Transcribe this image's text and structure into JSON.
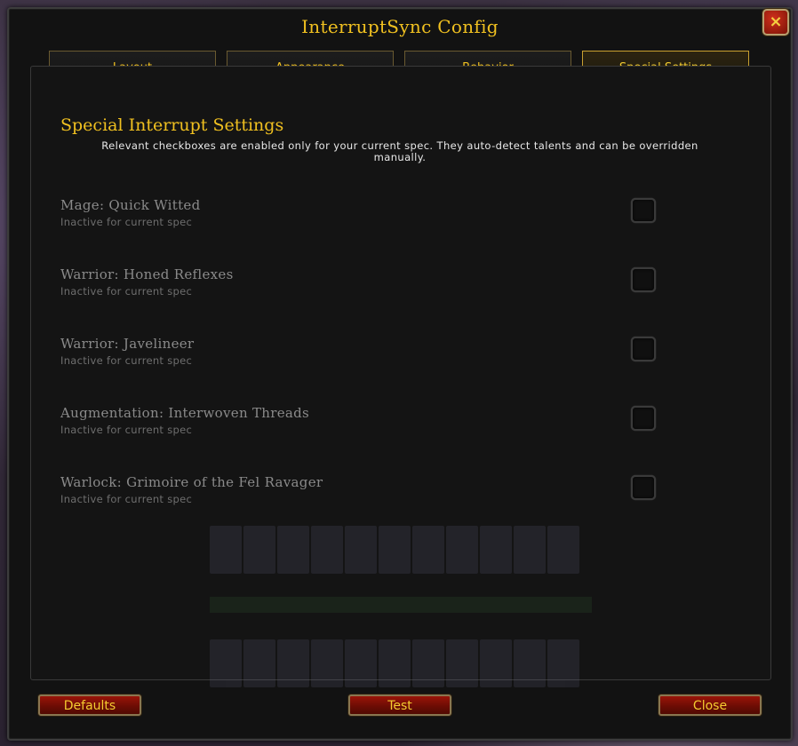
{
  "window": {
    "title": "InterruptSync Config",
    "close_icon": "×"
  },
  "tabs": [
    {
      "label": "Layout",
      "active": false
    },
    {
      "label": "Appearance",
      "active": false
    },
    {
      "label": "Behavior",
      "active": false
    },
    {
      "label": "Special Settings",
      "active": true
    }
  ],
  "section": {
    "title": "Special Interrupt Settings",
    "description": "Relevant checkboxes are enabled only for your current spec. They auto-detect talents and can be overridden manually."
  },
  "settings": [
    {
      "label": "Mage: Quick Witted",
      "status": "Inactive for current spec",
      "checked": false
    },
    {
      "label": "Warrior: Honed Reflexes",
      "status": "Inactive for current spec",
      "checked": false
    },
    {
      "label": "Warrior: Javelineer",
      "status": "Inactive for current spec",
      "checked": false
    },
    {
      "label": "Augmentation: Interwoven Threads",
      "status": "Inactive for current spec",
      "checked": false
    },
    {
      "label": "Warlock: Grimoire of the Fel Ravager",
      "status": "Inactive for current spec",
      "checked": false
    }
  ],
  "footer": {
    "defaults_label": "Defaults",
    "test_label": "Test",
    "close_label": "Close"
  },
  "colors": {
    "accent_gold": "#f0c020",
    "button_red": "#9a1408",
    "inactive_text": "#8a8a8a"
  }
}
